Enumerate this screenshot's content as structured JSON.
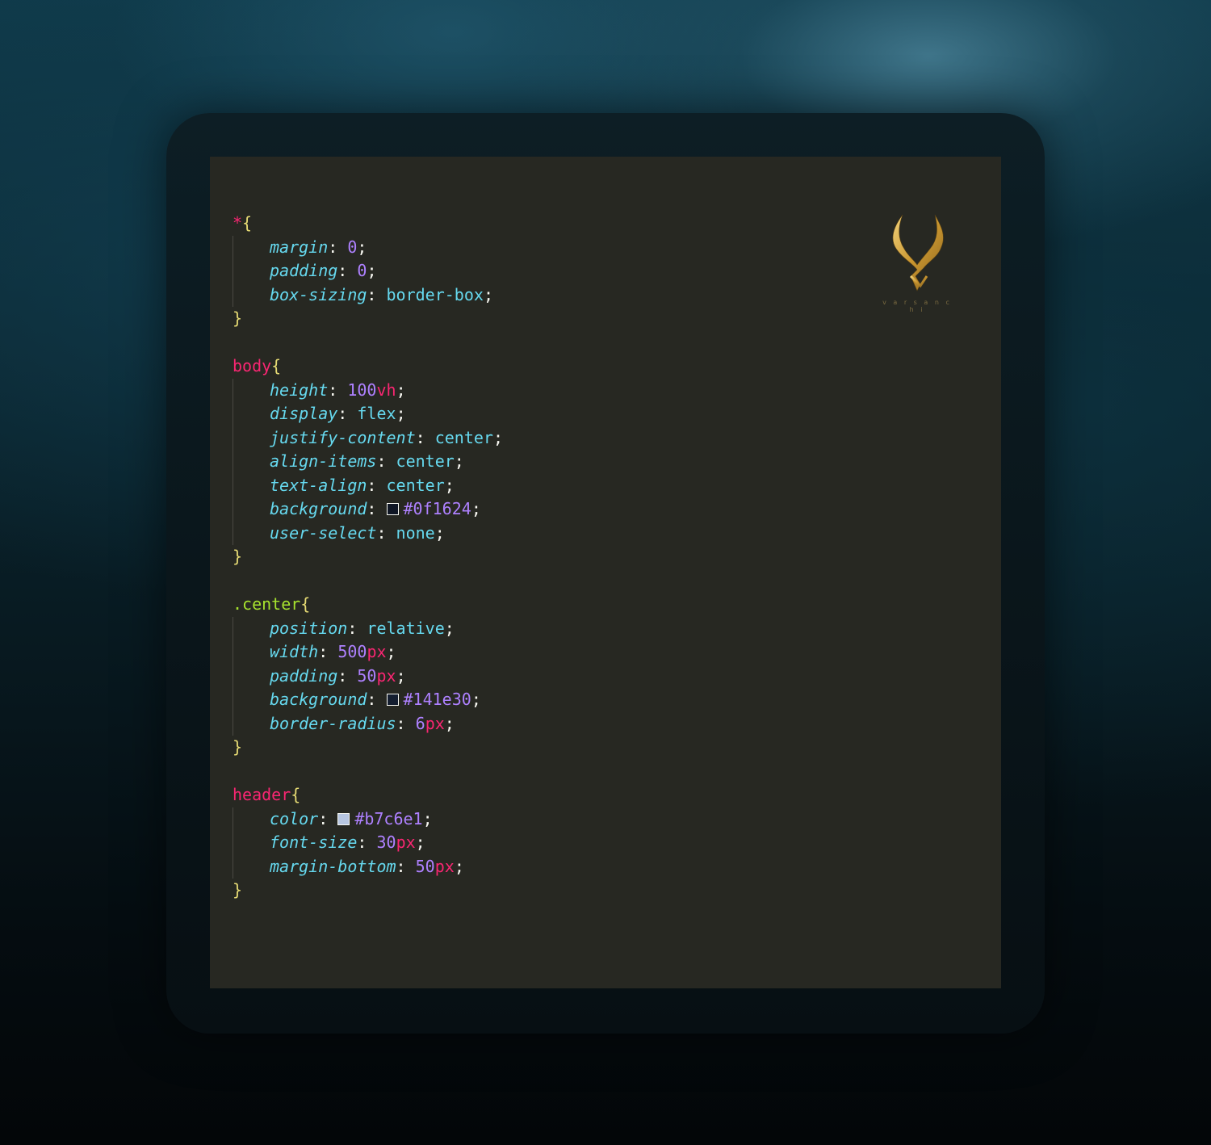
{
  "colors": {
    "editor_bg": "#272822",
    "selector": "#f92672",
    "class_selector": "#a6e22e",
    "brace": "#e6db74",
    "property": "#66d9ef",
    "number": "#ae81ff",
    "unit": "#f92672",
    "logo_gold": "#d4a94a"
  },
  "logo": {
    "icon": "horned-v-logo",
    "text": "v a r s a n c h i"
  },
  "code": {
    "blocks": [
      {
        "selector": "*",
        "selector_type": "element",
        "open": "{",
        "close": "}",
        "decls": [
          {
            "prop": "margin",
            "parts": [
              {
                "t": "num",
                "v": "0"
              }
            ]
          },
          {
            "prop": "padding",
            "parts": [
              {
                "t": "num",
                "v": "0"
              }
            ]
          },
          {
            "prop": "box-sizing",
            "parts": [
              {
                "t": "kw",
                "v": "border-box"
              }
            ]
          }
        ]
      },
      {
        "selector": "body",
        "selector_type": "element",
        "open": "{",
        "close": "}",
        "decls": [
          {
            "prop": "height",
            "parts": [
              {
                "t": "num",
                "v": "100"
              },
              {
                "t": "unit",
                "v": "vh"
              }
            ]
          },
          {
            "prop": "display",
            "parts": [
              {
                "t": "kw",
                "v": "flex"
              }
            ]
          },
          {
            "prop": "justify-content",
            "parts": [
              {
                "t": "kw",
                "v": "center"
              }
            ]
          },
          {
            "prop": "align-items",
            "parts": [
              {
                "t": "kw",
                "v": "center"
              }
            ]
          },
          {
            "prop": "text-align",
            "parts": [
              {
                "t": "kw",
                "v": "center"
              }
            ]
          },
          {
            "prop": "background",
            "parts": [
              {
                "t": "swatch",
                "v": "#0f1624"
              },
              {
                "t": "hex",
                "v": "#0f1624"
              }
            ]
          },
          {
            "prop": "user-select",
            "parts": [
              {
                "t": "kw",
                "v": "none"
              }
            ]
          }
        ]
      },
      {
        "selector": ".center",
        "selector_type": "class",
        "open": "{",
        "close": "}",
        "decls": [
          {
            "prop": "position",
            "parts": [
              {
                "t": "kw",
                "v": "relative"
              }
            ]
          },
          {
            "prop": "width",
            "parts": [
              {
                "t": "num",
                "v": "500"
              },
              {
                "t": "unit",
                "v": "px"
              }
            ]
          },
          {
            "prop": "padding",
            "parts": [
              {
                "t": "num",
                "v": "50"
              },
              {
                "t": "unit",
                "v": "px"
              }
            ]
          },
          {
            "prop": "background",
            "parts": [
              {
                "t": "swatch",
                "v": "#141e30"
              },
              {
                "t": "hex",
                "v": "#141e30"
              }
            ]
          },
          {
            "prop": "border-radius",
            "parts": [
              {
                "t": "num",
                "v": "6"
              },
              {
                "t": "unit",
                "v": "px"
              }
            ]
          }
        ]
      },
      {
        "selector": "header",
        "selector_type": "element",
        "open": "{",
        "close": "}",
        "decls": [
          {
            "prop": "color",
            "parts": [
              {
                "t": "swatch",
                "v": "#b7c6e1"
              },
              {
                "t": "hex",
                "v": "#b7c6e1"
              }
            ]
          },
          {
            "prop": "font-size",
            "parts": [
              {
                "t": "num",
                "v": "30"
              },
              {
                "t": "unit",
                "v": "px"
              }
            ]
          },
          {
            "prop": "margin-bottom",
            "parts": [
              {
                "t": "num",
                "v": "50"
              },
              {
                "t": "unit",
                "v": "px"
              }
            ]
          }
        ]
      }
    ]
  }
}
